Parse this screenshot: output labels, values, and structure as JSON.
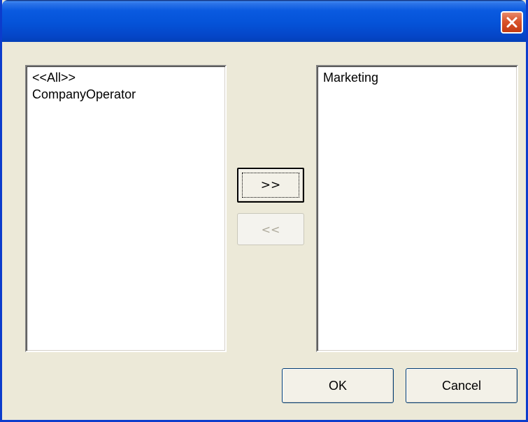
{
  "window": {
    "title": "",
    "close_icon": "close-icon"
  },
  "available_list": {
    "items": [
      "<<All>>",
      "CompanyOperator"
    ]
  },
  "selected_list": {
    "items": [
      "Marketing"
    ]
  },
  "buttons": {
    "add_label": ">>",
    "remove_label": "<<",
    "ok_label": "OK",
    "cancel_label": "Cancel"
  },
  "colors": {
    "titlebar": "#0553d8",
    "dialog_face": "#ece9d8",
    "close_button": "#d9542b",
    "disabled_text": "#aca899"
  }
}
